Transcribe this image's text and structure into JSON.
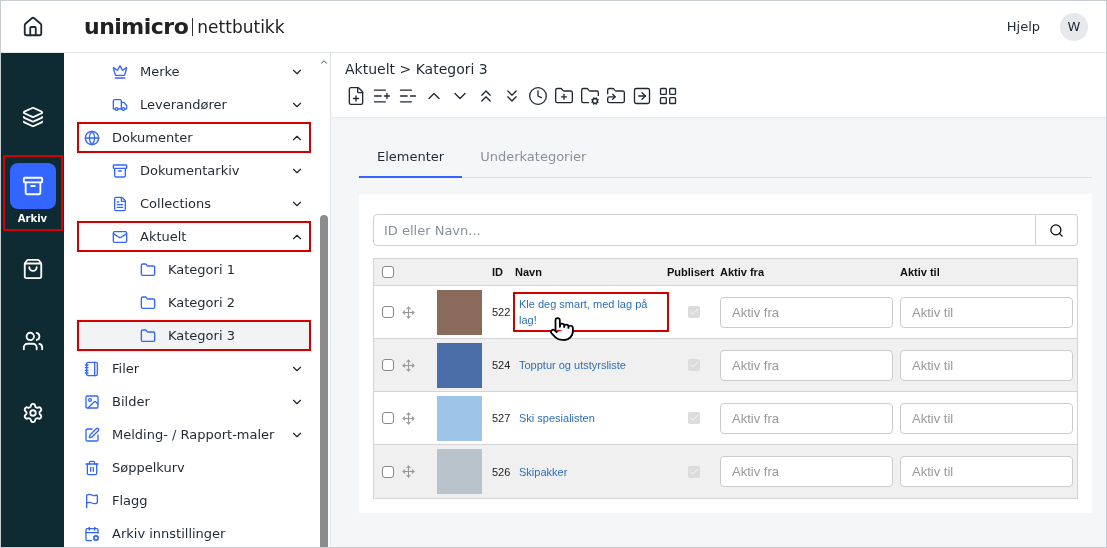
{
  "topbar": {
    "logo_main": "unimicro",
    "logo_sub": "nettbutikk",
    "help": "Hjelp",
    "avatar": "W"
  },
  "rail": [
    {
      "selected": false,
      "highlighted": false
    },
    {
      "label": "Arkiv",
      "selected": true,
      "highlighted": true
    },
    {
      "selected": false,
      "highlighted": false
    },
    {
      "selected": false,
      "highlighted": false
    },
    {
      "selected": false,
      "highlighted": false
    }
  ],
  "nav": {
    "continued_children": [
      {
        "label": "Merke",
        "expanded": false,
        "highlighted": false
      },
      {
        "label": "Leverandører",
        "expanded": false,
        "highlighted": false
      }
    ],
    "items": [
      {
        "label": "Dokumenter",
        "expanded": true,
        "highlighted": true,
        "children": [
          {
            "label": "Dokumentarkiv",
            "expanded": false,
            "highlighted": false
          },
          {
            "label": "Collections",
            "expanded": false,
            "highlighted": false
          },
          {
            "label": "Aktuelt",
            "expanded": true,
            "highlighted": true,
            "children": [
              {
                "label": "Kategori 1",
                "selected": false,
                "highlighted": false
              },
              {
                "label": "Kategori 2",
                "selected": false,
                "highlighted": false
              },
              {
                "label": "Kategori 3",
                "selected": true,
                "highlighted": true
              }
            ]
          }
        ]
      },
      {
        "label": "Filer",
        "expanded": false,
        "highlighted": false
      },
      {
        "label": "Bilder",
        "expanded": false,
        "highlighted": false
      },
      {
        "label": "Melding- / Rapport-maler",
        "expanded": false,
        "highlighted": false
      },
      {
        "label": "Søppelkurv",
        "highlighted": false
      },
      {
        "label": "Flagg",
        "highlighted": false
      },
      {
        "label": "Arkiv innstillinger",
        "highlighted": false
      }
    ]
  },
  "breadcrumb": "Aktuelt > Kategori 3",
  "tabs": [
    {
      "label": "Elementer",
      "selected": true
    },
    {
      "label": "Underkategorier",
      "selected": false
    }
  ],
  "search": {
    "placeholder": "ID eller Navn..."
  },
  "table": {
    "select_all_checked": false,
    "columns": [
      "ID",
      "Navn",
      "Publisert",
      "Aktiv fra",
      "Aktiv til"
    ],
    "rows": [
      {
        "id": "522",
        "name": "Kle deg smart, med lag på lag!",
        "checked": false,
        "published": true,
        "highlighted": true,
        "from_placeholder": "Aktiv fra",
        "to_placeholder": "Aktiv til"
      },
      {
        "id": "524",
        "name": "Topptur og utstyrsliste",
        "checked": false,
        "published": true,
        "highlighted": false,
        "from_placeholder": "Aktiv fra",
        "to_placeholder": "Aktiv til"
      },
      {
        "id": "527",
        "name": "Ski spesialisten",
        "checked": false,
        "published": true,
        "highlighted": false,
        "from_placeholder": "Aktiv fra",
        "to_placeholder": "Aktiv til"
      },
      {
        "id": "526",
        "name": "Skipakker",
        "checked": false,
        "published": true,
        "highlighted": false,
        "from_placeholder": "Aktiv fra",
        "to_placeholder": "Aktiv til"
      }
    ]
  }
}
